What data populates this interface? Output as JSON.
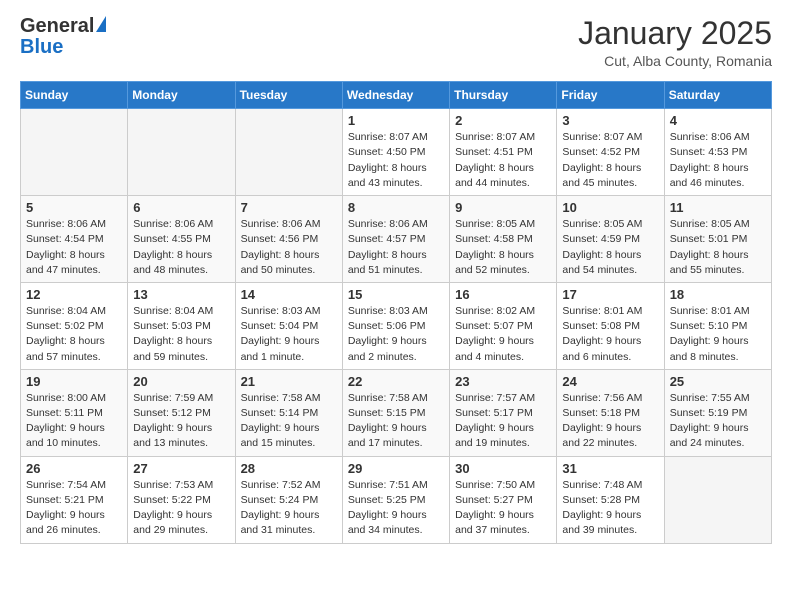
{
  "header": {
    "logo_general": "General",
    "logo_blue": "Blue",
    "month_title": "January 2025",
    "location": "Cut, Alba County, Romania"
  },
  "weekdays": [
    "Sunday",
    "Monday",
    "Tuesday",
    "Wednesday",
    "Thursday",
    "Friday",
    "Saturday"
  ],
  "weeks": [
    [
      {
        "day": "",
        "sunrise": "",
        "sunset": "",
        "daylight": ""
      },
      {
        "day": "",
        "sunrise": "",
        "sunset": "",
        "daylight": ""
      },
      {
        "day": "",
        "sunrise": "",
        "sunset": "",
        "daylight": ""
      },
      {
        "day": "1",
        "sunrise": "Sunrise: 8:07 AM",
        "sunset": "Sunset: 4:50 PM",
        "daylight": "Daylight: 8 hours and 43 minutes."
      },
      {
        "day": "2",
        "sunrise": "Sunrise: 8:07 AM",
        "sunset": "Sunset: 4:51 PM",
        "daylight": "Daylight: 8 hours and 44 minutes."
      },
      {
        "day": "3",
        "sunrise": "Sunrise: 8:07 AM",
        "sunset": "Sunset: 4:52 PM",
        "daylight": "Daylight: 8 hours and 45 minutes."
      },
      {
        "day": "4",
        "sunrise": "Sunrise: 8:06 AM",
        "sunset": "Sunset: 4:53 PM",
        "daylight": "Daylight: 8 hours and 46 minutes."
      }
    ],
    [
      {
        "day": "5",
        "sunrise": "Sunrise: 8:06 AM",
        "sunset": "Sunset: 4:54 PM",
        "daylight": "Daylight: 8 hours and 47 minutes."
      },
      {
        "day": "6",
        "sunrise": "Sunrise: 8:06 AM",
        "sunset": "Sunset: 4:55 PM",
        "daylight": "Daylight: 8 hours and 48 minutes."
      },
      {
        "day": "7",
        "sunrise": "Sunrise: 8:06 AM",
        "sunset": "Sunset: 4:56 PM",
        "daylight": "Daylight: 8 hours and 50 minutes."
      },
      {
        "day": "8",
        "sunrise": "Sunrise: 8:06 AM",
        "sunset": "Sunset: 4:57 PM",
        "daylight": "Daylight: 8 hours and 51 minutes."
      },
      {
        "day": "9",
        "sunrise": "Sunrise: 8:05 AM",
        "sunset": "Sunset: 4:58 PM",
        "daylight": "Daylight: 8 hours and 52 minutes."
      },
      {
        "day": "10",
        "sunrise": "Sunrise: 8:05 AM",
        "sunset": "Sunset: 4:59 PM",
        "daylight": "Daylight: 8 hours and 54 minutes."
      },
      {
        "day": "11",
        "sunrise": "Sunrise: 8:05 AM",
        "sunset": "Sunset: 5:01 PM",
        "daylight": "Daylight: 8 hours and 55 minutes."
      }
    ],
    [
      {
        "day": "12",
        "sunrise": "Sunrise: 8:04 AM",
        "sunset": "Sunset: 5:02 PM",
        "daylight": "Daylight: 8 hours and 57 minutes."
      },
      {
        "day": "13",
        "sunrise": "Sunrise: 8:04 AM",
        "sunset": "Sunset: 5:03 PM",
        "daylight": "Daylight: 8 hours and 59 minutes."
      },
      {
        "day": "14",
        "sunrise": "Sunrise: 8:03 AM",
        "sunset": "Sunset: 5:04 PM",
        "daylight": "Daylight: 9 hours and 1 minute."
      },
      {
        "day": "15",
        "sunrise": "Sunrise: 8:03 AM",
        "sunset": "Sunset: 5:06 PM",
        "daylight": "Daylight: 9 hours and 2 minutes."
      },
      {
        "day": "16",
        "sunrise": "Sunrise: 8:02 AM",
        "sunset": "Sunset: 5:07 PM",
        "daylight": "Daylight: 9 hours and 4 minutes."
      },
      {
        "day": "17",
        "sunrise": "Sunrise: 8:01 AM",
        "sunset": "Sunset: 5:08 PM",
        "daylight": "Daylight: 9 hours and 6 minutes."
      },
      {
        "day": "18",
        "sunrise": "Sunrise: 8:01 AM",
        "sunset": "Sunset: 5:10 PM",
        "daylight": "Daylight: 9 hours and 8 minutes."
      }
    ],
    [
      {
        "day": "19",
        "sunrise": "Sunrise: 8:00 AM",
        "sunset": "Sunset: 5:11 PM",
        "daylight": "Daylight: 9 hours and 10 minutes."
      },
      {
        "day": "20",
        "sunrise": "Sunrise: 7:59 AM",
        "sunset": "Sunset: 5:12 PM",
        "daylight": "Daylight: 9 hours and 13 minutes."
      },
      {
        "day": "21",
        "sunrise": "Sunrise: 7:58 AM",
        "sunset": "Sunset: 5:14 PM",
        "daylight": "Daylight: 9 hours and 15 minutes."
      },
      {
        "day": "22",
        "sunrise": "Sunrise: 7:58 AM",
        "sunset": "Sunset: 5:15 PM",
        "daylight": "Daylight: 9 hours and 17 minutes."
      },
      {
        "day": "23",
        "sunrise": "Sunrise: 7:57 AM",
        "sunset": "Sunset: 5:17 PM",
        "daylight": "Daylight: 9 hours and 19 minutes."
      },
      {
        "day": "24",
        "sunrise": "Sunrise: 7:56 AM",
        "sunset": "Sunset: 5:18 PM",
        "daylight": "Daylight: 9 hours and 22 minutes."
      },
      {
        "day": "25",
        "sunrise": "Sunrise: 7:55 AM",
        "sunset": "Sunset: 5:19 PM",
        "daylight": "Daylight: 9 hours and 24 minutes."
      }
    ],
    [
      {
        "day": "26",
        "sunrise": "Sunrise: 7:54 AM",
        "sunset": "Sunset: 5:21 PM",
        "daylight": "Daylight: 9 hours and 26 minutes."
      },
      {
        "day": "27",
        "sunrise": "Sunrise: 7:53 AM",
        "sunset": "Sunset: 5:22 PM",
        "daylight": "Daylight: 9 hours and 29 minutes."
      },
      {
        "day": "28",
        "sunrise": "Sunrise: 7:52 AM",
        "sunset": "Sunset: 5:24 PM",
        "daylight": "Daylight: 9 hours and 31 minutes."
      },
      {
        "day": "29",
        "sunrise": "Sunrise: 7:51 AM",
        "sunset": "Sunset: 5:25 PM",
        "daylight": "Daylight: 9 hours and 34 minutes."
      },
      {
        "day": "30",
        "sunrise": "Sunrise: 7:50 AM",
        "sunset": "Sunset: 5:27 PM",
        "daylight": "Daylight: 9 hours and 37 minutes."
      },
      {
        "day": "31",
        "sunrise": "Sunrise: 7:48 AM",
        "sunset": "Sunset: 5:28 PM",
        "daylight": "Daylight: 9 hours and 39 minutes."
      },
      {
        "day": "",
        "sunrise": "",
        "sunset": "",
        "daylight": ""
      }
    ]
  ]
}
